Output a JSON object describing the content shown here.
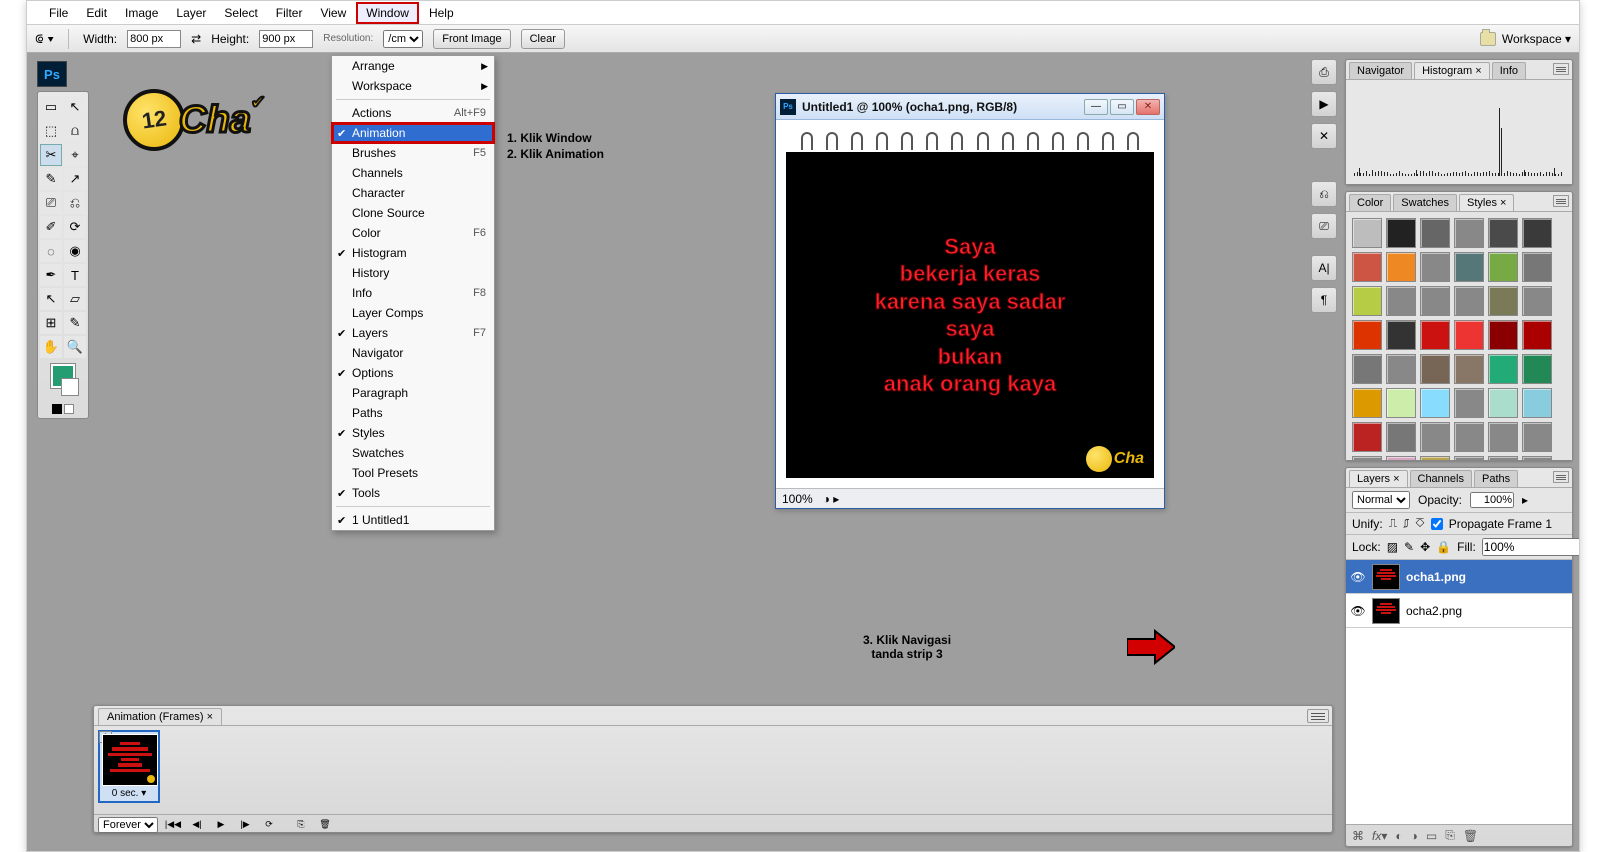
{
  "menubar": [
    "File",
    "Edit",
    "Image",
    "Layer",
    "Select",
    "Filter",
    "View",
    "Window",
    "Help"
  ],
  "menubar_open_index": 7,
  "optionsbar": {
    "width_label": "Width:",
    "width_val": "800 px",
    "height_label": "Height:",
    "height_val": "900 px",
    "unit": "/cm",
    "front_image": "Front Image",
    "clear": "Clear",
    "workspace": "Workspace ▾"
  },
  "window_menu": {
    "groups": [
      [
        {
          "label": "Arrange",
          "sub": true
        },
        {
          "label": "Workspace",
          "sub": true
        }
      ],
      [
        {
          "label": "Actions",
          "shortcut": "Alt+F9"
        },
        {
          "label": "Animation",
          "checked": true,
          "selected": true,
          "boxed": true
        },
        {
          "label": "Brushes",
          "shortcut": "F5"
        },
        {
          "label": "Channels"
        },
        {
          "label": "Character"
        },
        {
          "label": "Clone Source"
        },
        {
          "label": "Color",
          "shortcut": "F6"
        },
        {
          "label": "Histogram",
          "checked": true
        },
        {
          "label": "History"
        },
        {
          "label": "Info",
          "shortcut": "F8"
        },
        {
          "label": "Layer Comps"
        },
        {
          "label": "Layers",
          "checked": true,
          "shortcut": "F7"
        },
        {
          "label": "Navigator"
        },
        {
          "label": "Options",
          "checked": true
        },
        {
          "label": "Paragraph"
        },
        {
          "label": "Paths"
        },
        {
          "label": "Styles",
          "checked": true
        },
        {
          "label": "Swatches"
        },
        {
          "label": "Tool Presets"
        },
        {
          "label": "Tools",
          "checked": true
        }
      ],
      [
        {
          "label": "1 Untitled1",
          "checked": true
        }
      ]
    ]
  },
  "annotations": {
    "step1": "1. Klik Window",
    "step2": "2. Klik Animation",
    "step3a": "3. Klik Navigasi",
    "step3b": "tanda strip 3"
  },
  "document": {
    "title": "Untitled1 @ 100% (ocha1.png, RGB/8)",
    "lines": [
      "Saya",
      "bekerja keras",
      "karena saya sadar",
      "saya",
      "bukan",
      "anak orang kaya"
    ],
    "logo_text": "Cha",
    "zoom": "100%"
  },
  "animation_panel": {
    "tab": "Animation (Frames) ×",
    "frame_number": "1",
    "frame_duration": "0 sec. ▾",
    "loop": "Forever"
  },
  "histogram_panel": {
    "tabs": [
      "Navigator",
      "Histogram ×",
      "Info"
    ],
    "active": 1
  },
  "styles_panel": {
    "tabs": [
      "Color",
      "Swatches",
      "Styles ×"
    ],
    "active": 2,
    "swatches": [
      "#bdbdbd",
      "#222",
      "#666",
      "#888",
      "#4a4a4a",
      "#3a3a3a",
      "#c54",
      "#e82",
      "#888",
      "#577",
      "#7a4",
      "#777",
      "#b6cc45",
      "#888",
      "#888",
      "#888",
      "#7a7a58",
      "#888",
      "#d30",
      "#333",
      "#c11",
      "#e33",
      "#8a0000",
      "#a00",
      "#777",
      "#888",
      "#765",
      "#876",
      "#2a7",
      "#285",
      "#d90",
      "#cea",
      "#8df",
      "#888",
      "#adc",
      "#8cd",
      "#b22",
      "#777",
      "#888",
      "#888",
      "#888",
      "#888",
      "#888",
      "#d9a6c2",
      "#bba44c",
      "#888",
      "#888",
      "#888"
    ]
  },
  "layers_panel": {
    "tabs": [
      "Layers ×",
      "Channels",
      "Paths"
    ],
    "active": 0,
    "blend": "Normal",
    "opacity_label": "Opacity:",
    "opacity": "100%",
    "unify": "Unify:",
    "propagate": "Propagate Frame 1",
    "lock": "Lock:",
    "fill_label": "Fill:",
    "fill": "100%",
    "layers": [
      {
        "name": "ocha1.png",
        "active": true
      },
      {
        "name": "ocha2.png",
        "active": false
      }
    ]
  },
  "toolbox_rows": [
    [
      "▭",
      "↖"
    ],
    [
      "⬚",
      "⩍"
    ],
    [
      "✂",
      "⌖"
    ],
    [
      "✎",
      "↗"
    ],
    [
      "⎚",
      "⎌"
    ],
    [
      "✐",
      "⟳"
    ],
    [
      "◌",
      "◉"
    ],
    [
      "✒",
      "T"
    ],
    [
      "↖",
      "▱"
    ],
    [
      "⊞",
      "✎"
    ],
    [
      "✋",
      "🔍"
    ]
  ],
  "logo": {
    "ball_num": "12",
    "text": "Cha"
  }
}
